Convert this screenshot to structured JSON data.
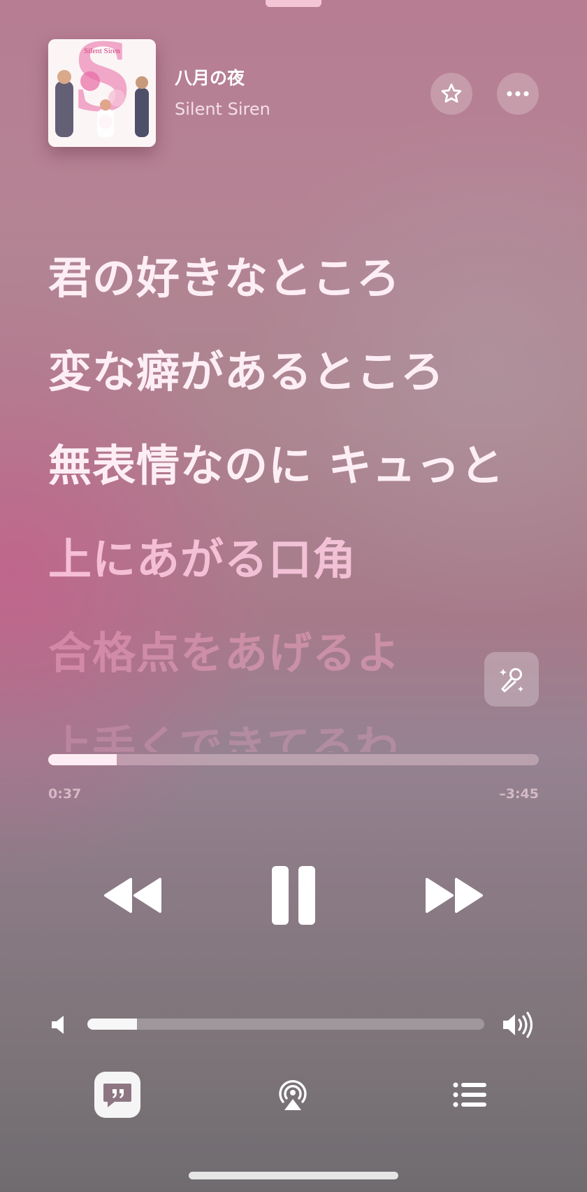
{
  "now_playing": {
    "title": "八月の夜",
    "artist": "Silent Siren",
    "album_art_label": "Silent Siren",
    "is_favorite": false
  },
  "lyrics": {
    "lines": [
      "君の好きなところ",
      "変な癖があるところ",
      "無表情なのに キュっと",
      "上にあがる口角",
      "合格点をあげるよ",
      "上手くできてるわ"
    ]
  },
  "playback": {
    "elapsed": "0:37",
    "remaining": "–3:45",
    "progress_fraction": 0.14,
    "state": "playing"
  },
  "volume": {
    "level_fraction": 0.125
  },
  "bottom_bar": {
    "lyrics_active": true
  },
  "colors": {
    "background_top": "#b77d93",
    "background_bottom": "#6f6c70",
    "lyric_active": "#fff2f8",
    "lyric_upcoming": "#ffcde2"
  },
  "icons": [
    "star-icon",
    "ellipsis-icon",
    "sing-microphone-icon",
    "rewind-icon",
    "pause-icon",
    "fast-forward-icon",
    "speaker-low-icon",
    "speaker-high-icon",
    "lyrics-quote-icon",
    "airplay-icon",
    "queue-list-icon"
  ]
}
